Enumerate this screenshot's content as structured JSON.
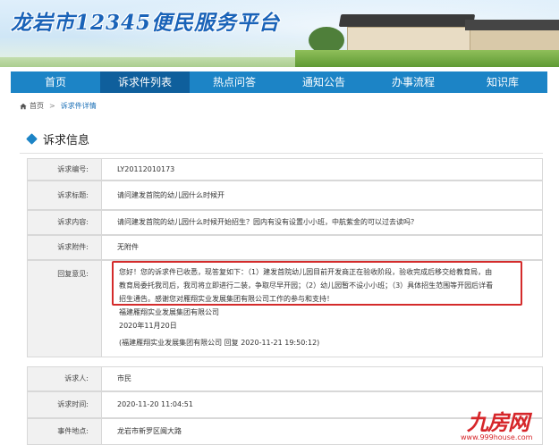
{
  "header": {
    "site_title": "龙岩市12345便民服务平台"
  },
  "nav": {
    "items": [
      {
        "label": "首页",
        "active": false
      },
      {
        "label": "诉求件列表",
        "active": true
      },
      {
        "label": "热点问答",
        "active": false
      },
      {
        "label": "通知公告",
        "active": false
      },
      {
        "label": "办事流程",
        "active": false
      },
      {
        "label": "知识库",
        "active": false
      }
    ]
  },
  "breadcrumb": {
    "home": "首页",
    "separator": ">",
    "current": "诉求件详情"
  },
  "section": {
    "title": "诉求信息"
  },
  "fields": {
    "id": {
      "label": "诉求编号:",
      "value": "LY20112010173"
    },
    "title": {
      "label": "诉求标题:",
      "value": "请问建发首院的幼儿园什么时候开"
    },
    "content": {
      "label": "诉求内容:",
      "value": "请问建发首院的幼儿园什么时候开始招生？园内有没有设置小小班，中航紫金的可以过去读吗？"
    },
    "attachment": {
      "label": "诉求附件:",
      "value": "无附件"
    },
    "reply": {
      "label": "回复意见:",
      "lines": [
        "您好！您的诉求件已收悉，现答复如下：（1）建发首院幼儿园目前开发商正在验收阶段，验收完成后移交给教育局，由",
        "教育局委托我司后，我司将立即进行二装，争取尽早开园；（2）幼儿园暂不设小小班；（3）具体招生范围等开园后详看",
        "招生通告。感谢您对雁翔实业发展集团有限公司工作的参与和支持！"
      ],
      "org": "福建雁翔实业发展集团有限公司",
      "date": "2020年11月20日",
      "footer": "(福建雁翔实业发展集团有限公司 回复 2020-11-21 19:50:12)"
    },
    "person": {
      "label": "诉求人:",
      "value": "市民"
    },
    "time": {
      "label": "诉求时间:",
      "value": "2020-11-20 11:04:51"
    },
    "location": {
      "label": "事件地点:",
      "value": "龙岩市新罗区闽大路"
    }
  },
  "watermark": {
    "brand": "九房网",
    "url": "www.999house.com"
  },
  "colors": {
    "nav": "#1c84c6",
    "nav_active": "#0f5f9c",
    "highlight_border": "#d42b2b",
    "watermark": "#d6262a"
  }
}
